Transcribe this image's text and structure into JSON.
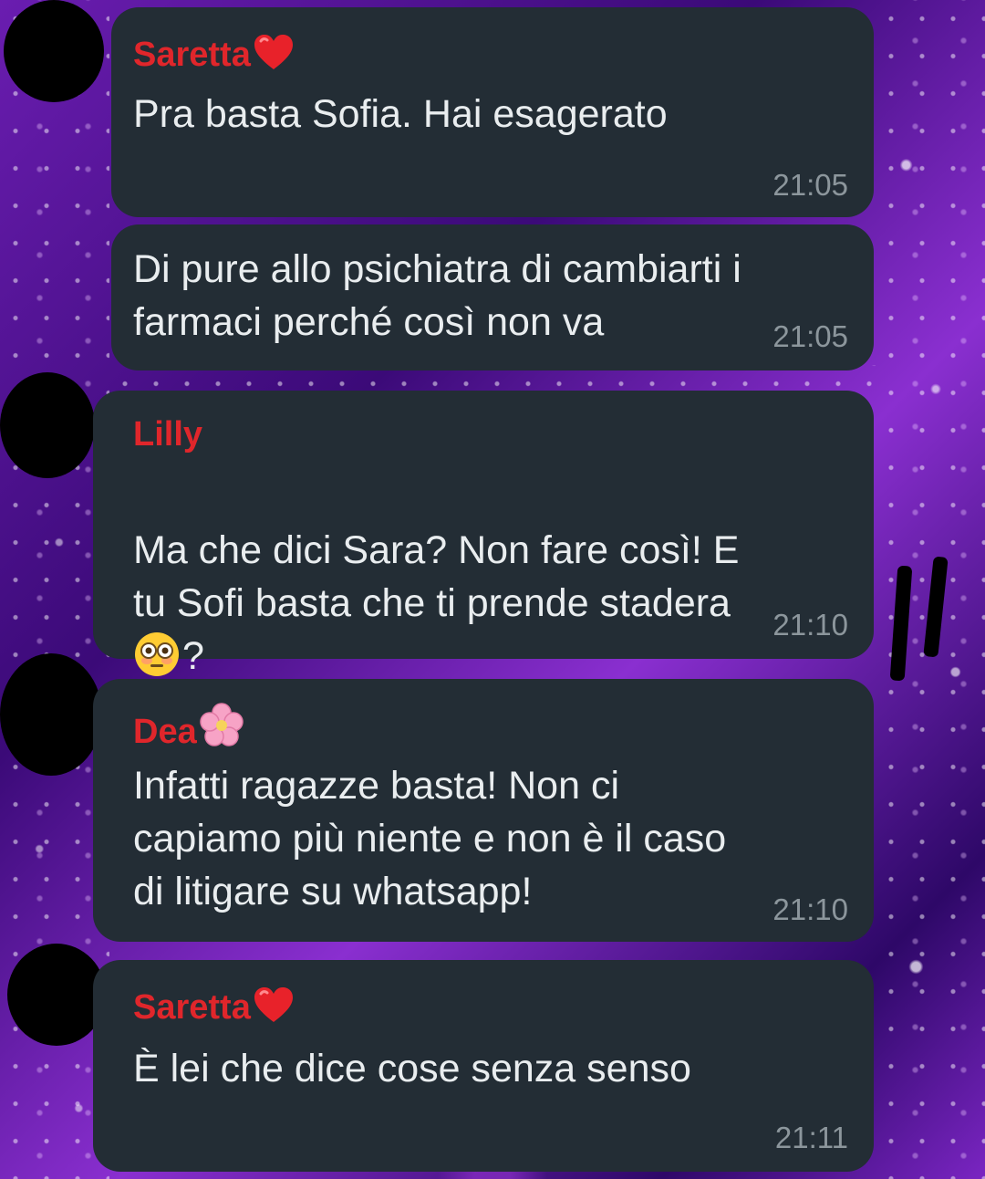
{
  "colors": {
    "bubble_bg": "#232d35",
    "message_text": "#e9edef",
    "timestamp": "#8c969c",
    "sender_name": "#e0262b"
  },
  "messages": [
    {
      "sender": "Saretta",
      "sender_emoji": "red-heart-icon",
      "text": "Pra basta Sofia. Hai esagerato",
      "time": "21:05"
    },
    {
      "sender": "",
      "text": "Di pure allo psichiatra di cambiarti i\nfarmaci perché così non va",
      "time": "21:05"
    },
    {
      "sender": "Lilly",
      "text": "Ma che dici Sara? Non fare così! E\ntu Sofi basta che ti prende stadera",
      "text_tail": "?",
      "text_tail_emoji": "flushed-face-icon",
      "time": "21:10"
    },
    {
      "sender": "Dea",
      "sender_emoji": "cherry-blossom-icon",
      "text": "Infatti ragazze basta! Non ci\ncapiamo più niente e non è il caso\ndi litigare su whatsapp!",
      "time": "21:10"
    },
    {
      "sender": "Saretta",
      "sender_emoji": "red-heart-icon",
      "text": "È lei che dice cose senza senso",
      "time": "21:11"
    }
  ]
}
